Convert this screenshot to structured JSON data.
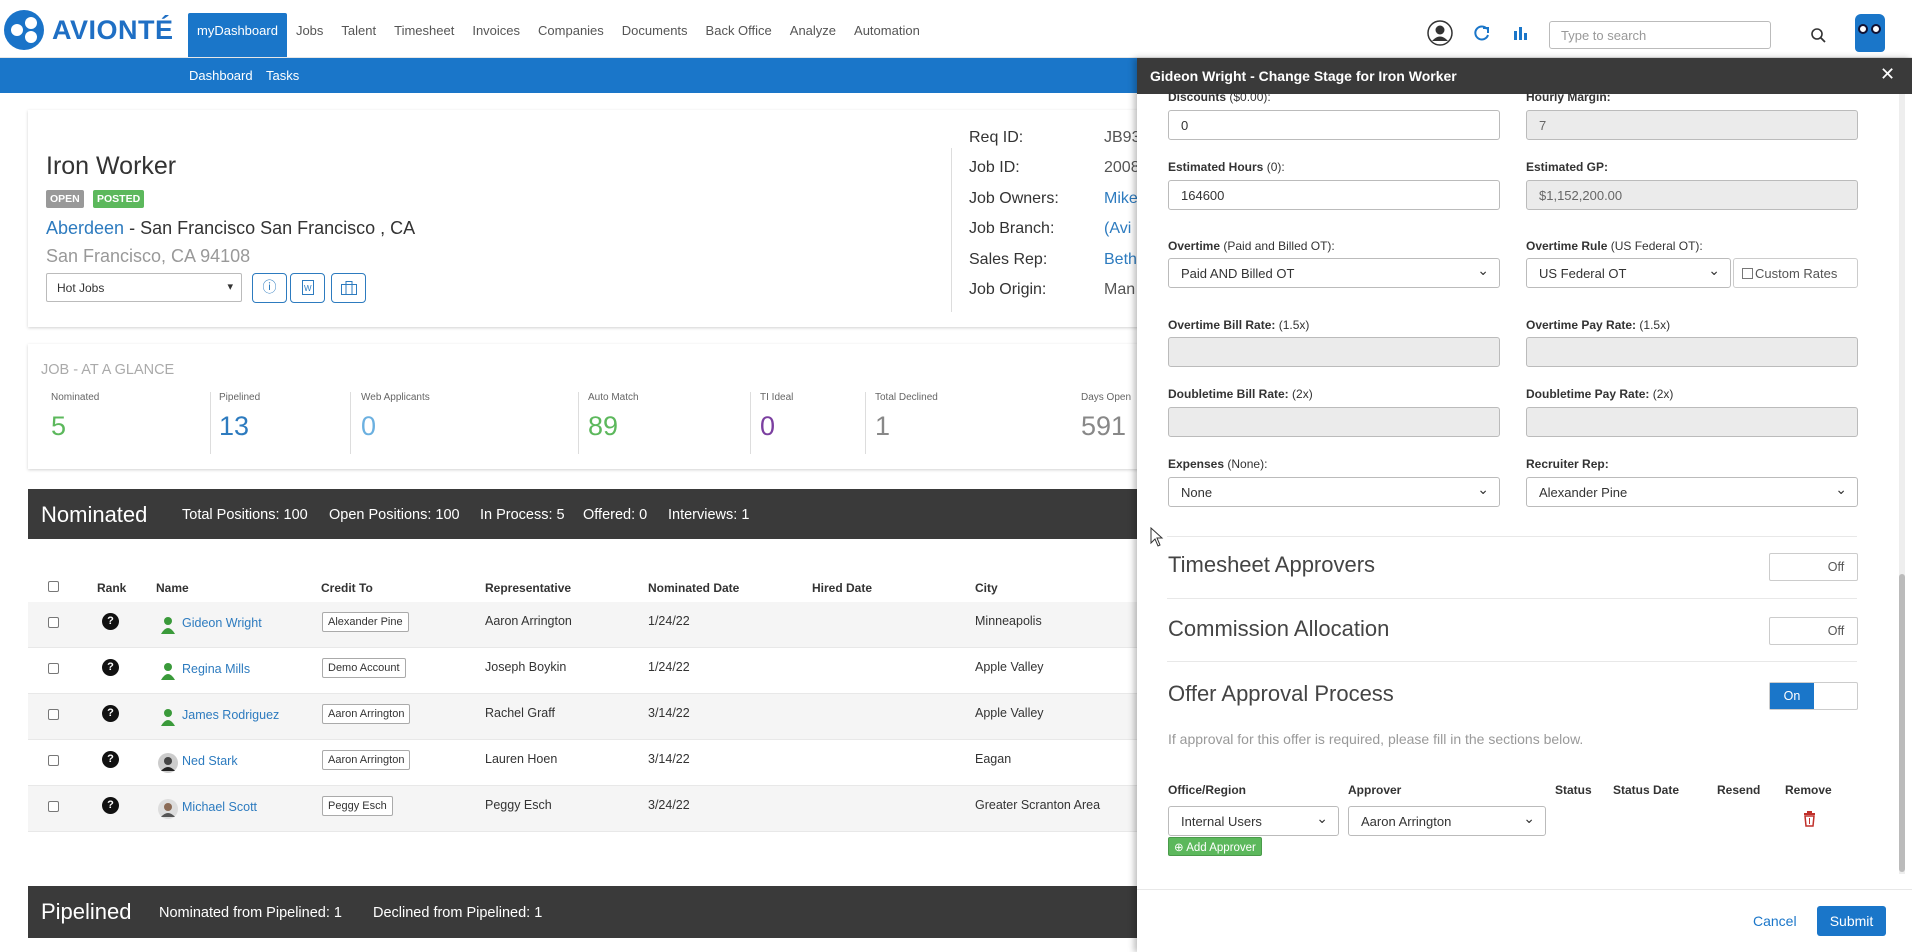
{
  "app": {
    "logo": "AVIONTÉ",
    "search_placeholder": "Type to search"
  },
  "nav": [
    "myDashboard",
    "Jobs",
    "Talent",
    "Timesheet",
    "Invoices",
    "Companies",
    "Documents",
    "Back Office",
    "Analyze",
    "Automation"
  ],
  "subnav": {
    "dashboard": "Dashboard",
    "tasks": "Tasks"
  },
  "job": {
    "title": "Iron Worker",
    "badge_open": "OPEN",
    "badge_posted": "POSTED",
    "location_link": "Aberdeen",
    "location_rest": " - San Francisco San Francisco , CA",
    "address": "San Francisco, CA 94108",
    "list_select": "Hot Jobs"
  },
  "job_info": {
    "labels": [
      "Req ID:",
      "Job ID:",
      "Job Owners:",
      "Job Branch:",
      "Sales Rep:",
      "Job Origin:"
    ],
    "values": [
      "JB93",
      "2008",
      "Mike",
      "(Avi",
      "Beth",
      "Man"
    ]
  },
  "glance": {
    "title": "JOB - AT A GLANCE",
    "stats": [
      {
        "label": "Nominated",
        "value": "5"
      },
      {
        "label": "Pipelined",
        "value": "13"
      },
      {
        "label": "Web Applicants",
        "value": "0"
      },
      {
        "label": "Auto Match",
        "value": "89"
      },
      {
        "label": "TI Ideal",
        "value": "0"
      },
      {
        "label": "Total Declined",
        "value": "1"
      },
      {
        "label": "Days Open",
        "value": "591"
      }
    ]
  },
  "nominated": {
    "title": "Nominated",
    "stats": [
      "Total Positions: 100",
      "Open Positions: 100",
      "In Process: 5",
      "Offered: 0",
      "Interviews: 1"
    ]
  },
  "table": {
    "headers": [
      "Rank",
      "Name",
      "Credit To",
      "Representative",
      "Nominated Date",
      "Hired Date",
      "City"
    ],
    "rows": [
      {
        "name": "Gideon Wright",
        "credit": "Alexander Pine",
        "rep": "Aaron Arrington",
        "date": "1/24/22",
        "city": "Minneapolis"
      },
      {
        "name": "Regina Mills",
        "credit": "Demo Account",
        "rep": "Joseph Boykin",
        "date": "1/24/22",
        "city": "Apple Valley"
      },
      {
        "name": "James Rodriguez",
        "credit": "Aaron Arrington",
        "rep": "Rachel Graff",
        "date": "3/14/22",
        "city": "Apple Valley"
      },
      {
        "name": "Ned Stark",
        "credit": "Aaron Arrington",
        "rep": "Lauren Hoen",
        "date": "3/14/22",
        "city": "Eagan"
      },
      {
        "name": "Michael Scott",
        "credit": "Peggy Esch",
        "rep": "Peggy Esch",
        "date": "3/24/22",
        "city": "Greater Scranton Area"
      }
    ]
  },
  "pipelined": {
    "title": "Pipelined",
    "stats": [
      "Nominated from Pipelined: 1",
      "Declined from Pipelined: 1"
    ]
  },
  "panel": {
    "title": "Gideon Wright - Change Stage for Iron Worker",
    "discounts_label": "Discounts",
    "discounts_hint": "($0.00):",
    "discounts_value": "0",
    "hourly_margin_label": "Hourly Margin:",
    "hourly_margin_value": "7",
    "est_hours_label": "Estimated Hours",
    "est_hours_hint": "(0):",
    "est_hours_value": "164600",
    "est_gp_label": "Estimated GP:",
    "est_gp_value": "$1,152,200.00",
    "overtime_label": "Overtime",
    "overtime_hint": "(Paid and Billed OT):",
    "overtime_value": "Paid AND Billed OT",
    "ot_rule_label": "Overtime Rule",
    "ot_rule_hint": "(US Federal OT):",
    "ot_rule_value": "US Federal OT",
    "custom_rates": "Custom Rates",
    "ot_bill_label": "Overtime Bill Rate:",
    "ot_bill_hint": "(1.5x)",
    "ot_pay_label": "Overtime Pay Rate:",
    "ot_pay_hint": "(1.5x)",
    "dt_bill_label": "Doubletime Bill Rate:",
    "dt_bill_hint": "(2x)",
    "dt_pay_label": "Doubletime Pay Rate:",
    "dt_pay_hint": "(2x)",
    "expenses_label": "Expenses",
    "expenses_hint": "(None):",
    "expenses_value": "None",
    "recruiter_label": "Recruiter Rep:",
    "recruiter_value": "Alexander Pine",
    "timesheet_title": "Timesheet Approvers",
    "commission_title": "Commission Allocation",
    "offer_title": "Offer Approval Process",
    "toggle_off": "Off",
    "toggle_on": "On",
    "offer_note": "If approval for this offer is required, please fill in the sections below.",
    "approver_headers": [
      "Office/Region",
      "Approver",
      "Status",
      "Status Date",
      "Resend",
      "Remove"
    ],
    "office_value": "Internal Users",
    "approver_value": "Aaron Arrington",
    "add_approver": "Add Approver",
    "cancel": "Cancel",
    "submit": "Submit"
  },
  "colors": {
    "brand": "#1a76c9",
    "green": "#5cb85c",
    "purple": "#7b3fa0",
    "dark": "#3a3a3a"
  }
}
